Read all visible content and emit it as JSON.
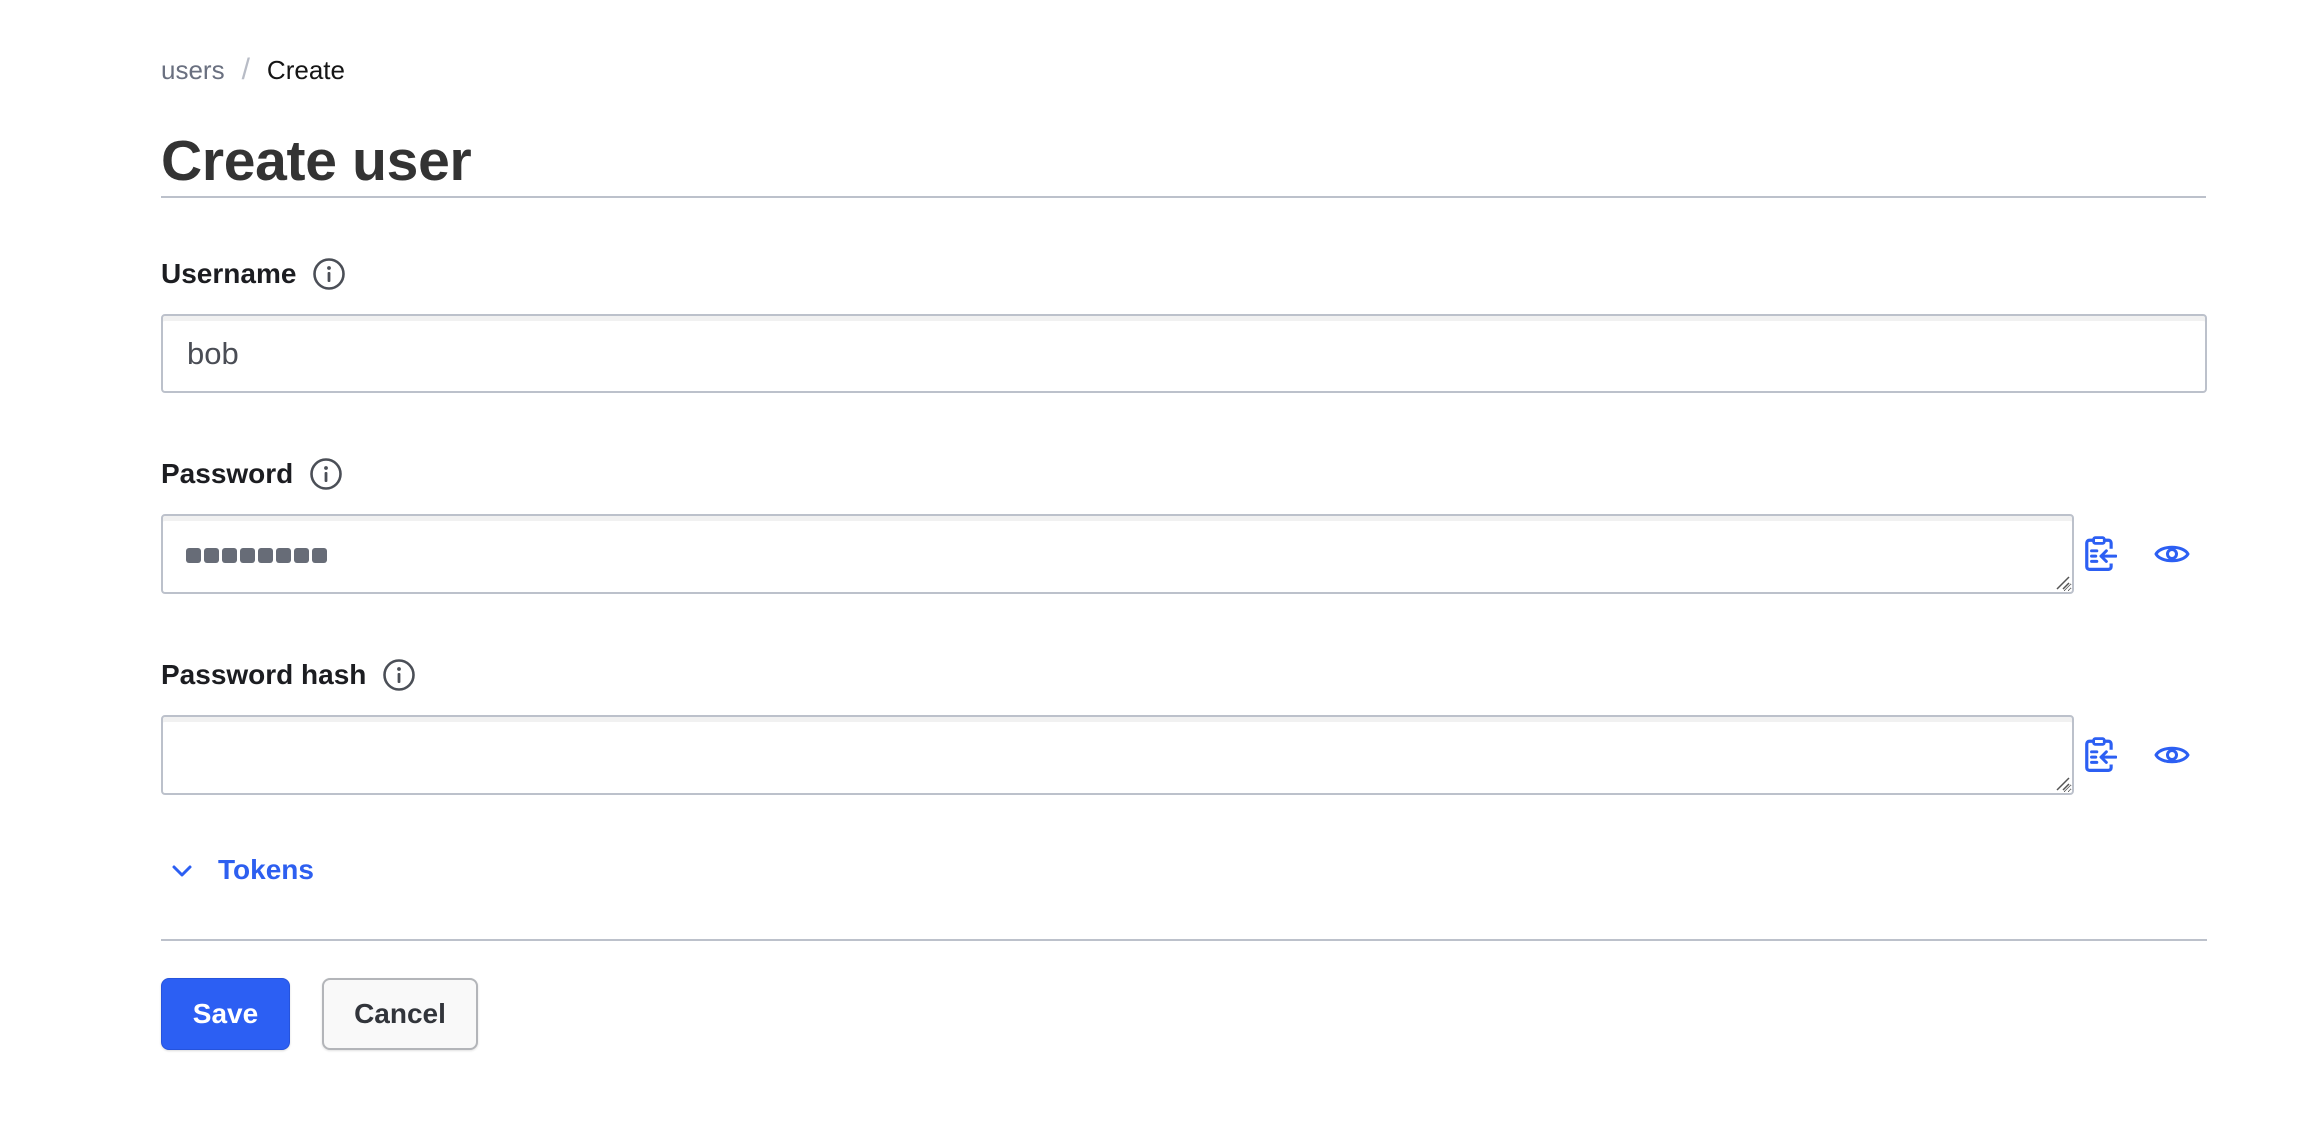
{
  "breadcrumb": {
    "items": [
      {
        "label": "users",
        "link": true
      },
      {
        "label": "Create",
        "link": false
      }
    ],
    "separator": "/"
  },
  "page": {
    "title": "Create user"
  },
  "form": {
    "username": {
      "label": "Username",
      "value": "bob",
      "info_icon": "info-circle-icon"
    },
    "password": {
      "label": "Password",
      "masked_length": 8,
      "info_icon": "info-circle-icon",
      "actions": [
        {
          "icon": "clipboard-paste-icon",
          "label": "Paste from clipboard"
        },
        {
          "icon": "eye-icon",
          "label": "Show value"
        }
      ]
    },
    "password_hash": {
      "label": "Password hash",
      "value": "",
      "info_icon": "info-circle-icon",
      "actions": [
        {
          "icon": "clipboard-paste-icon",
          "label": "Paste from clipboard"
        },
        {
          "icon": "eye-icon",
          "label": "Show value"
        }
      ]
    },
    "tokens": {
      "label": "Tokens",
      "icon": "chevron-down-icon",
      "expanded": false
    }
  },
  "actions": {
    "save_label": "Save",
    "cancel_label": "Cancel"
  },
  "colors": {
    "accent": "#2c5ff3",
    "border": "#bcc1cb",
    "title": "#333333",
    "muted": "#6a7080"
  }
}
